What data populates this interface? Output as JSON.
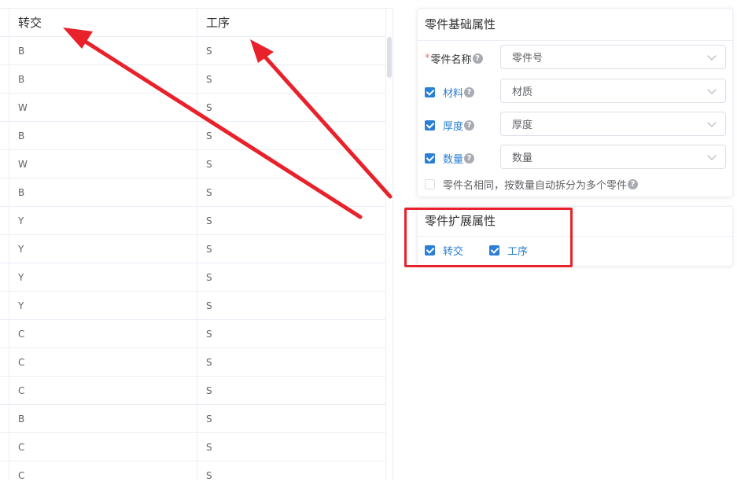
{
  "table": {
    "headers": {
      "col1": "转交",
      "col2": "工序"
    },
    "rows": [
      {
        "col1": "B",
        "col2": "S"
      },
      {
        "col1": "B",
        "col2": "S"
      },
      {
        "col1": "W",
        "col2": "S"
      },
      {
        "col1": "B",
        "col2": "S"
      },
      {
        "col1": "W",
        "col2": "S"
      },
      {
        "col1": "B",
        "col2": "S"
      },
      {
        "col1": "Y",
        "col2": "S"
      },
      {
        "col1": "Y",
        "col2": "S"
      },
      {
        "col1": "Y",
        "col2": "S"
      },
      {
        "col1": "Y",
        "col2": "S"
      },
      {
        "col1": "C",
        "col2": "S"
      },
      {
        "col1": "C",
        "col2": "S"
      },
      {
        "col1": "C",
        "col2": "S"
      },
      {
        "col1": "B",
        "col2": "S"
      },
      {
        "col1": "C",
        "col2": "S"
      },
      {
        "col1": "C",
        "col2": "S"
      }
    ]
  },
  "basic_panel": {
    "title": "零件基础属性",
    "required_mark": "*",
    "help_glyph": "?",
    "fields": [
      {
        "label": "零件名称",
        "value": "零件号",
        "checkbox": null
      },
      {
        "label": "材料",
        "value": "材质",
        "checkbox": true
      },
      {
        "label": "厚度",
        "value": "厚度",
        "checkbox": true
      },
      {
        "label": "数量",
        "value": "数量",
        "checkbox": true
      }
    ],
    "split_option": {
      "label": "零件名相同，按数量自动拆分为多个零件",
      "checked": false
    }
  },
  "ext_panel": {
    "title": "零件扩展属性",
    "options": [
      {
        "label": "转交",
        "checked": true
      },
      {
        "label": "工序",
        "checked": true
      }
    ]
  },
  "colors": {
    "accent": "#2a7fd4",
    "annotation_red": "#e8212a",
    "required": "#f56c6c"
  }
}
